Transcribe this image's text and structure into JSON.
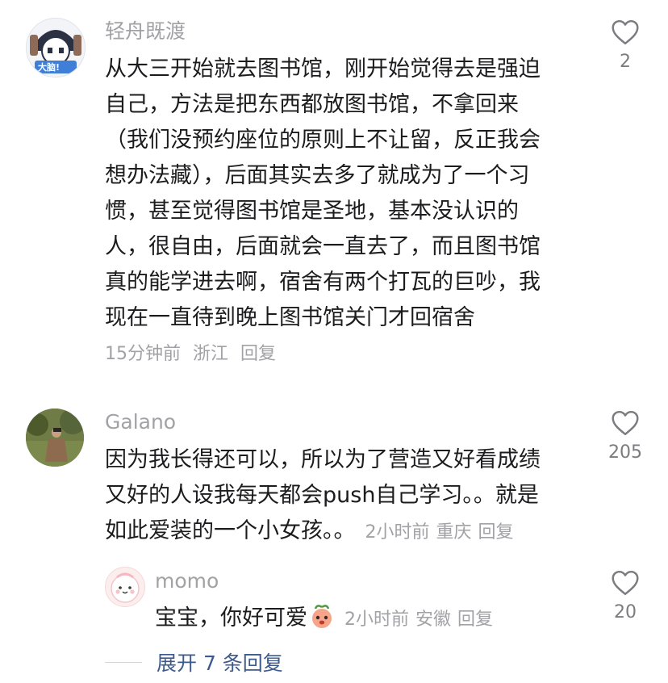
{
  "comments": [
    {
      "username": "轻舟既渡",
      "avatar_text": "大脑!",
      "lines": [
        "从大三开始就去图书馆，刚开始觉得去是强迫",
        "自己，方法是把东西都放图书馆，不拿回来",
        "（我们没预约座位的原则上不让留，反正我会",
        "想办法藏），后面其实去多了就成为了一个习",
        "惯，甚至觉得图书馆是圣地，基本没认识的",
        "人，很自由，后面就会一直去了，而且图书馆",
        "真的能学进去啊，宿舍有两个打瓦的巨吵，我",
        "现在一直待到晚上图书馆关门才回宿舍"
      ],
      "time": "15分钟前",
      "location": "浙江",
      "reply_label": "回复",
      "likes": "2"
    },
    {
      "username": "Galano",
      "lines": [
        "因为我长得还可以，所以为了营造又好看成绩",
        "又好的人设我每天都会push自己学习。。就是",
        "如此爱装的一个小女孩。。"
      ],
      "time": "2小时前",
      "location": "重庆",
      "reply_label": "回复",
      "likes": "205"
    },
    {
      "username": "momo",
      "text": "宝宝，你好可爱",
      "emoji": "peach-face",
      "time": "2小时前",
      "location": "安徽",
      "reply_label": "回复",
      "likes": "20"
    }
  ],
  "expand_replies": "展开 7 条回复",
  "colors": {
    "meta_gray": "#a2a2a6",
    "link_blue": "#3d5a8c",
    "text": "#1c1c1e"
  }
}
